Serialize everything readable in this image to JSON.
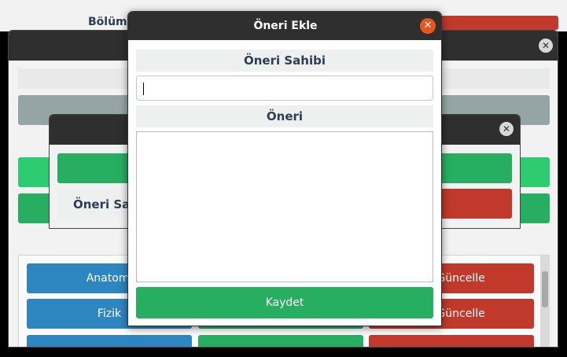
{
  "background_window": {
    "title_label": "Bölüm"
  },
  "list_buttons": {
    "row1": {
      "blue": "Anatomi",
      "red": "Ekle/Güncelle"
    },
    "row2": {
      "blue": "Fizik",
      "red": "Ekle/Güncelle"
    }
  },
  "small_dialog": {
    "owner_label": "Öneri Sahibi"
  },
  "dialog": {
    "title": "Öneri Ekle",
    "close_icon": "close-icon",
    "owner_section_label": "Öneri Sahibi",
    "owner_input_value": "",
    "suggestion_section_label": "Öneri",
    "suggestion_value": "",
    "save_label": "Kaydet"
  },
  "colors": {
    "title_bar": "#2f2f2f",
    "close_accent": "#e95420",
    "save_green": "#27ae60",
    "light_green": "#2ecc71",
    "danger_red": "#c0392b",
    "info_blue": "#2e86c1"
  }
}
